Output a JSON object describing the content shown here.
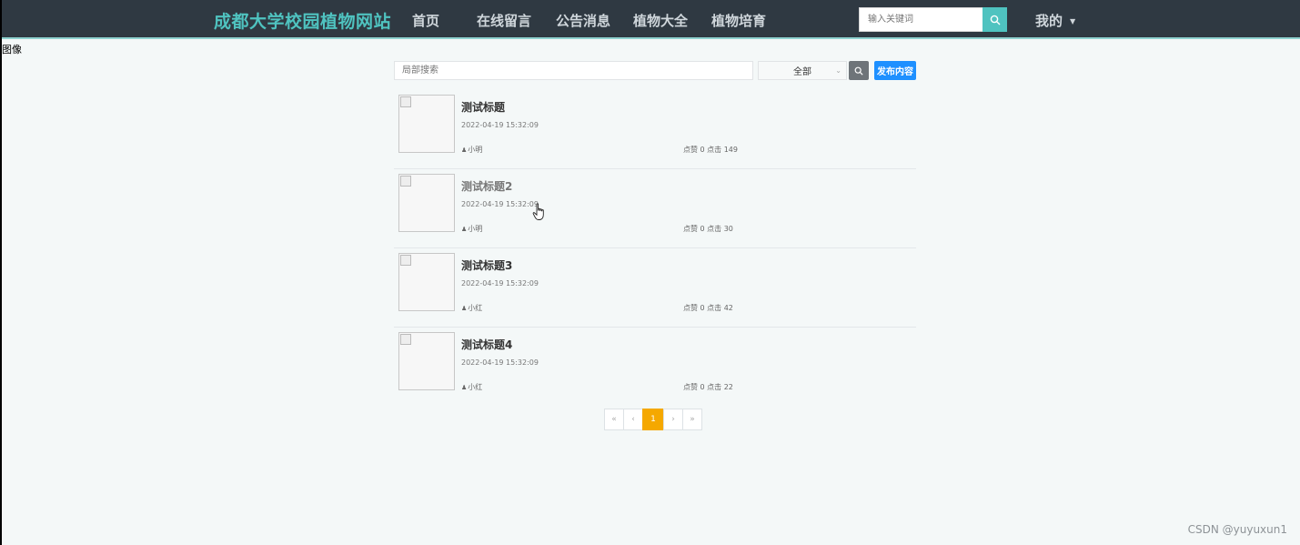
{
  "header": {
    "brand": "成都大学校园植物网站",
    "nav": [
      "首页",
      "在线留言",
      "公告消息",
      "植物大全",
      "植物培育"
    ],
    "search_placeholder": "输入关键词",
    "user_menu": "我的"
  },
  "broken_image_alt": "图像",
  "toolbar": {
    "search_placeholder": "局部搜索",
    "category_selected": "全部",
    "publish_label": "发布内容"
  },
  "items": [
    {
      "title": "测试标题",
      "date": "2022-04-19 15:32:09",
      "author": "小明",
      "stats": "点赞 0 点击 149"
    },
    {
      "title": "测试标题2",
      "date": "2022-04-19 15:32:09",
      "author": "小明",
      "stats": "点赞 0 点击 30"
    },
    {
      "title": "测试标题3",
      "date": "2022-04-19 15:32:09",
      "author": "小红",
      "stats": "点赞 0 点击 42"
    },
    {
      "title": "测试标题4",
      "date": "2022-04-19 15:32:09",
      "author": "小红",
      "stats": "点赞 0 点击 22"
    }
  ],
  "pagination": {
    "first": "«",
    "prev": "‹",
    "current": "1",
    "next": "›",
    "last": "»"
  },
  "watermark": "CSDN @yuyuxun1",
  "colors": {
    "nav_bg": "#2f3942",
    "brand": "#4fc3c0",
    "accent": "#4fc3c0",
    "publish": "#1e90ff",
    "page_active": "#f5a800"
  }
}
